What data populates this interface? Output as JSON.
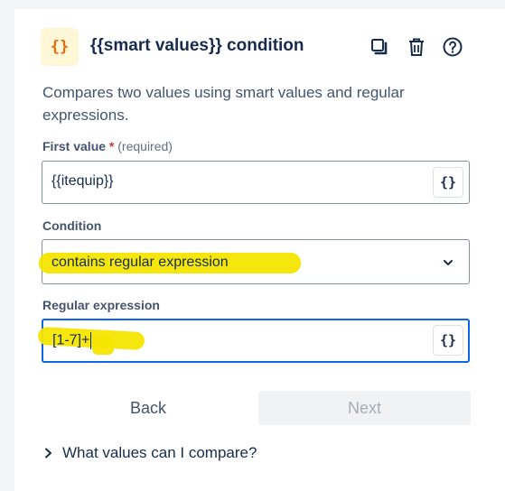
{
  "header": {
    "logo_glyph": "{}",
    "title": "{{smart values}} condition",
    "icons": [
      "duplicate-icon",
      "trash-icon",
      "help-icon"
    ]
  },
  "description": "Compares two values using smart values and regular expressions.",
  "first_value": {
    "label": "First value",
    "required_mark": "*",
    "required_note": "(required)",
    "value": "{{itequip}}",
    "smart_button": "{}"
  },
  "condition": {
    "label": "Condition",
    "selected": "contains regular expression"
  },
  "regex": {
    "label": "Regular expression",
    "value": "[1-7]+",
    "smart_button": "{}"
  },
  "actions": {
    "back": "Back",
    "next": "Next"
  },
  "help": {
    "disclosure": "What values can I compare?"
  },
  "colors": {
    "accent": "#0c66e4",
    "highlight": "#f4e500",
    "logo_bg": "#fff7d6",
    "logo_fg": "#e56910"
  }
}
